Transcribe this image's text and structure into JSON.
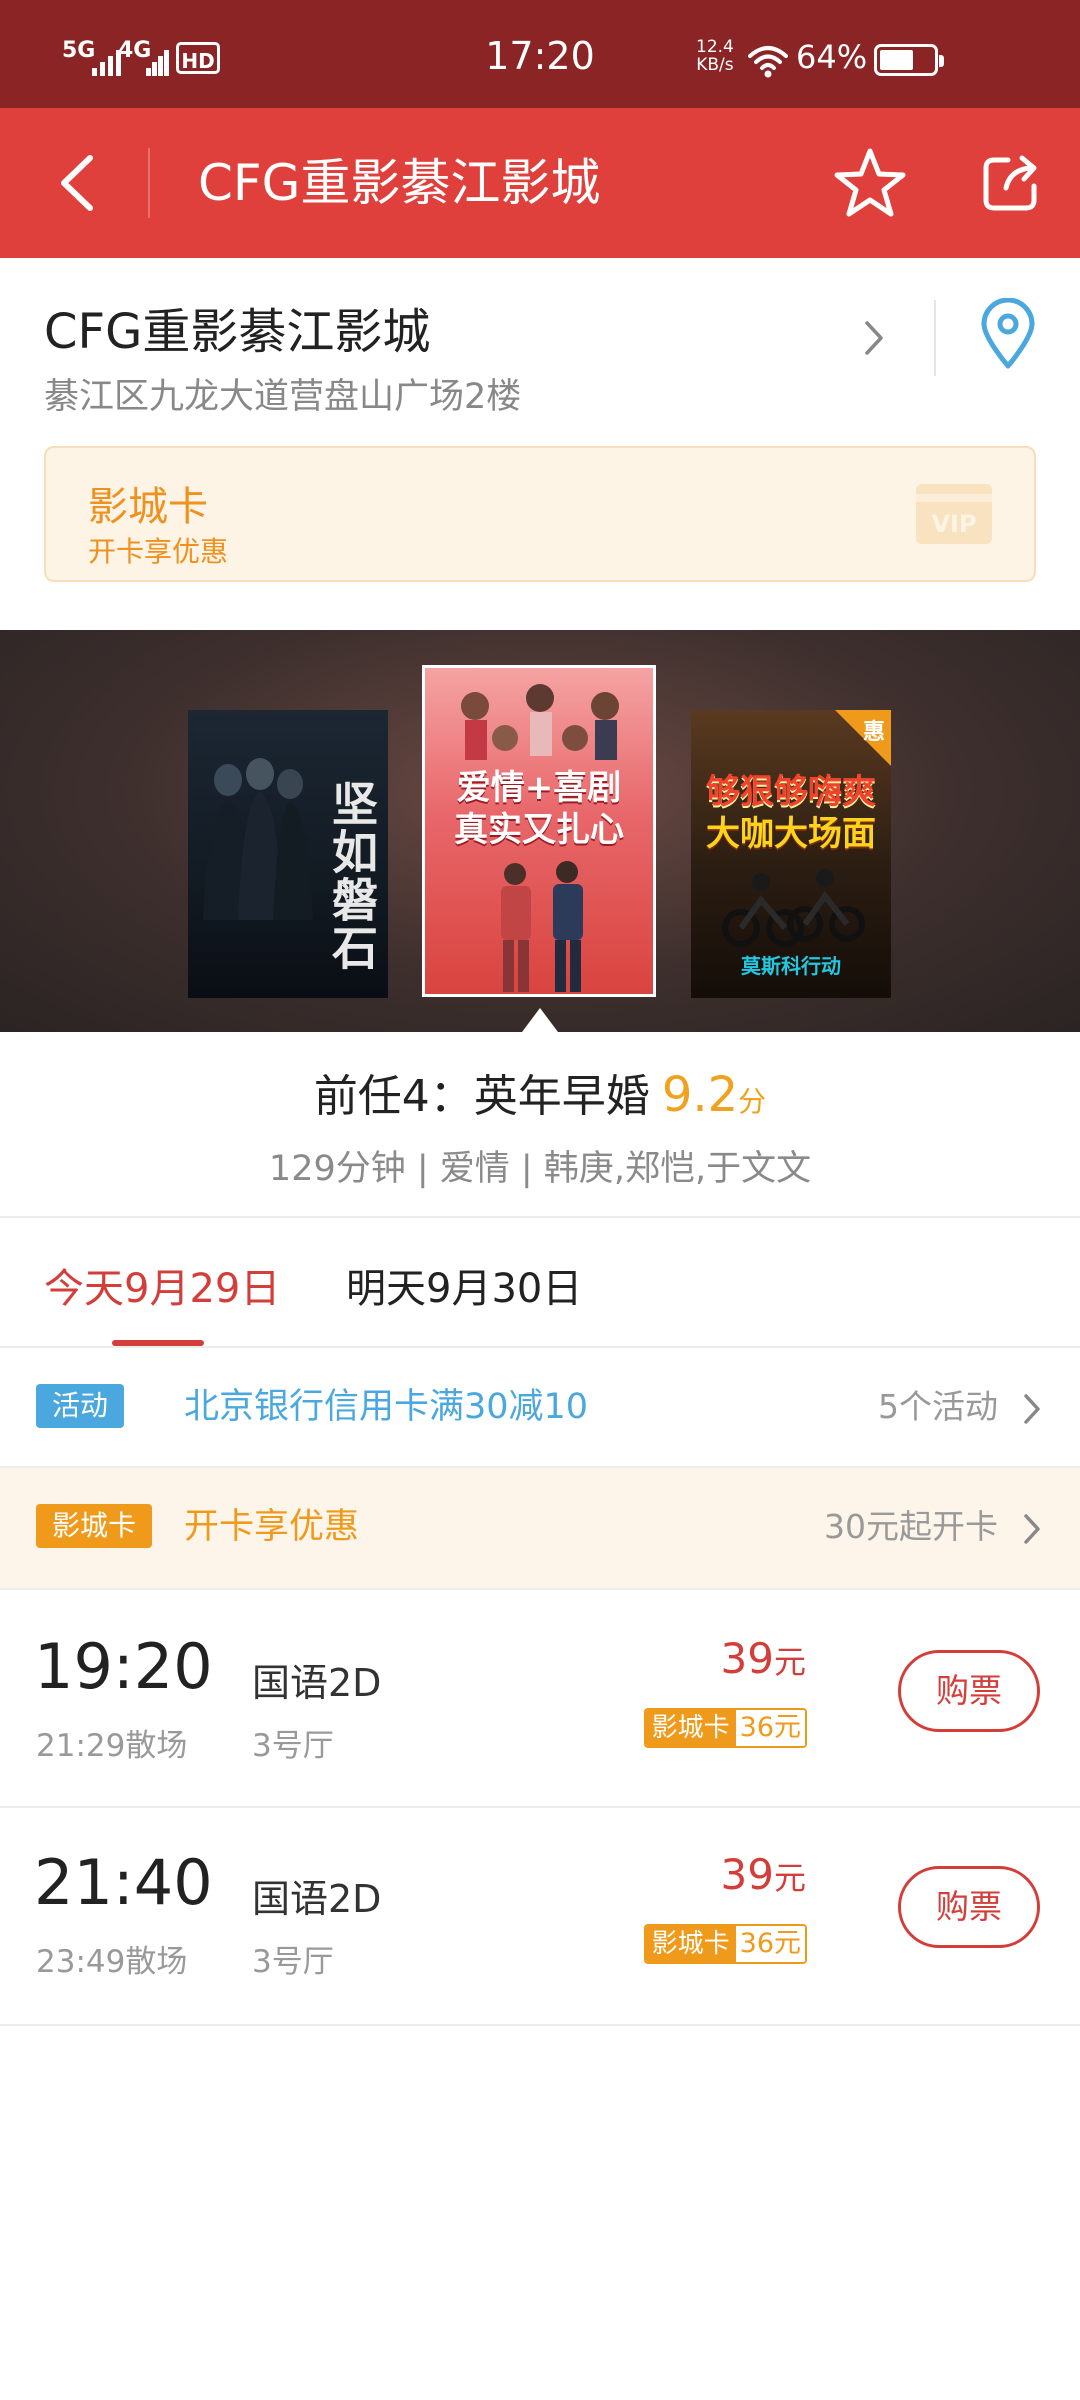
{
  "status_bar": {
    "net1": "5G",
    "net2": "4G",
    "hd": "HD",
    "time": "17:20",
    "speed_value": "12.4",
    "speed_unit": "KB/s",
    "battery_pct": "64%",
    "battery_level": 0.64
  },
  "header": {
    "title": "CFG重影綦江影城",
    "icons": [
      "back-icon",
      "star-icon",
      "share-icon"
    ]
  },
  "cinema": {
    "name": "CFG重影綦江影城",
    "address": "綦江区九龙大道营盘山广场2楼"
  },
  "card_banner": {
    "title": "影城卡",
    "subtitle": "开卡享优惠",
    "vip": "VIP"
  },
  "posters": [
    {
      "vertical_text": "坚如磐石"
    },
    {
      "line1": "爱情+喜剧",
      "line2": "真实又扎心"
    },
    {
      "corner_tag": "惠",
      "line1": "够狠够嗨爽",
      "line2": "大咖大场面",
      "bottom_title": "莫斯科行动"
    }
  ],
  "movie": {
    "title": "前任4：英年早婚",
    "score": "9.2",
    "score_unit": "分",
    "meta": "129分钟 | 爱情 | 韩庚,郑恺,于文文"
  },
  "date_tabs": {
    "today": "今天9月29日",
    "tomorrow": "明天9月30日"
  },
  "promos": {
    "activity": {
      "badge": "活动",
      "text": "北京银行信用卡满30减10",
      "right": "5个活动",
      "badge_color": "#4aa8df",
      "text_color": "#4aa8df"
    },
    "card": {
      "badge": "影城卡",
      "text": "开卡享优惠",
      "right": "30元起开卡",
      "badge_color": "#f09a1c",
      "text_color": "#f09a1c"
    }
  },
  "showtimes": [
    {
      "time": "19:20",
      "end": "21:29散场",
      "lang": "国语2D",
      "hall": "3号厅",
      "price": "39",
      "price_unit": "元",
      "card_label": "影城卡",
      "card_price": "36元",
      "buy": "购票"
    },
    {
      "time": "21:40",
      "end": "23:49散场",
      "lang": "国语2D",
      "hall": "3号厅",
      "price": "39",
      "price_unit": "元",
      "card_label": "影城卡",
      "card_price": "36元",
      "buy": "购票"
    }
  ],
  "colors": {
    "status_bar": "#8b2525",
    "header": "#e0403c",
    "accent_red": "#d43e3a",
    "orange": "#f09a1c",
    "score": "#f0a21f",
    "blue": "#4aa8df"
  }
}
